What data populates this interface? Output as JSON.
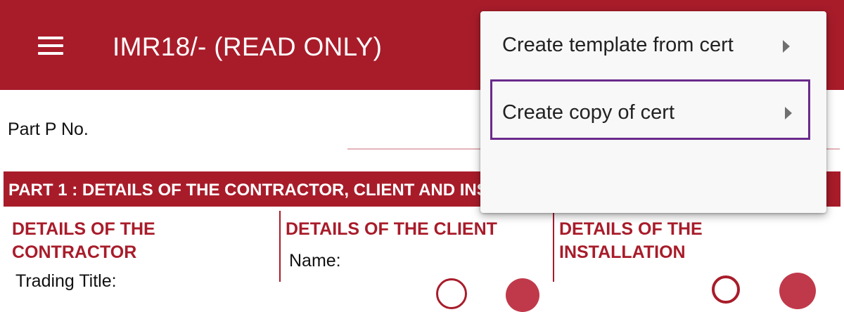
{
  "app_bar": {
    "title": "IMR18/- (READ ONLY)",
    "menu_icon": "hamburger-menu-icon"
  },
  "form": {
    "part_p_label": "Part P No.",
    "part1_header": "PART 1 : DETAILS OF THE CONTRACTOR, CLIENT AND INSTALLATION",
    "columns": [
      {
        "heading": "DETAILS OF THE CONTRACTOR",
        "field": "Trading Title:"
      },
      {
        "heading": "DETAILS OF THE CLIENT",
        "field": "Name:"
      },
      {
        "heading": "DETAILS OF THE INSTALLATION",
        "field": ""
      }
    ]
  },
  "context_menu": {
    "items": [
      {
        "label": "Create template from cert",
        "icon": "submenu-arrow-icon"
      },
      {
        "label": "Create copy of cert",
        "icon": "submenu-arrow-icon",
        "highlighted": true
      }
    ]
  },
  "colors": {
    "brand": "#a81c2a",
    "highlight_border": "#6a2a8c",
    "menu_background": "#f8f8f8"
  }
}
